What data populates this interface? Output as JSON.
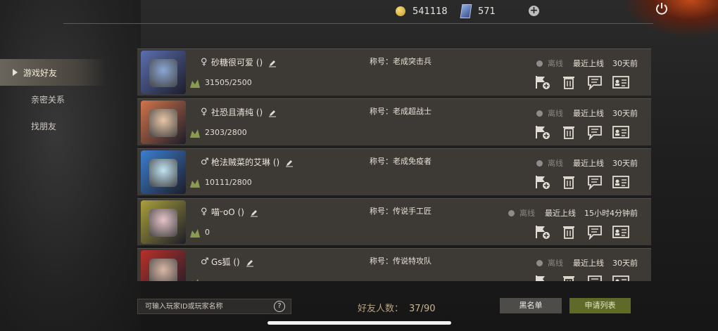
{
  "header": {
    "coins": "541118",
    "cards": "571",
    "coin_icon": "gold-coin-icon",
    "card_icon": "card-icon"
  },
  "sidebar": {
    "items": [
      {
        "label": "游戏好友",
        "active": true
      },
      {
        "label": "亲密关系",
        "active": false
      },
      {
        "label": "找朋友",
        "active": false
      }
    ]
  },
  "friends": [
    {
      "gender": "♀",
      "name": "砂糖很可爱 ()",
      "score": "31505/2500",
      "title": "称号：老成突击兵",
      "status": "离线",
      "last_label": "最近上线",
      "last_seen": "30天前",
      "frame_color": "#5a6fb0",
      "face_color": "#8aa6d6"
    },
    {
      "gender": "♀",
      "name": "社恐且清纯 ()",
      "score": "2303/2800",
      "title": "称号：老成超战士",
      "status": "离线",
      "last_label": "最近上线",
      "last_seen": "30天前",
      "frame_color": "#d0744a",
      "face_color": "#e8c6a6"
    },
    {
      "gender": "♂",
      "name": "枪法贼菜的艾琳 ()",
      "score": "10111/2800",
      "title": "称号：老成免疫者",
      "status": "离线",
      "last_label": "最近上线",
      "last_seen": "30天前",
      "frame_color": "#3b7fd0",
      "face_color": "#bfe3f2"
    },
    {
      "gender": "♀",
      "name": "喵ᵕoO ()",
      "score": "0",
      "title": "称号：传说手工匠",
      "status": "离线",
      "last_label": "最近上线",
      "last_seen": "15小时4分钟前",
      "frame_color": "#a9a03a",
      "face_color": "#e6c3c8"
    },
    {
      "gender": "♂",
      "name": "Gs狐 ()",
      "score": "",
      "title": "称号：传说特攻队",
      "status": "离线",
      "last_label": "最近上线",
      "last_seen": "30天前",
      "frame_color": "#b8302a",
      "face_color": "#d9b7a4"
    }
  ],
  "footer": {
    "search_placeholder": "可输入玩家ID或玩家名称",
    "friend_count_label": "好友人数：",
    "friend_count": "37/90",
    "blacklist_label": "黑名单",
    "apply_label": "申请列表"
  },
  "colors": {
    "accent_green": "#5f6a2a",
    "row_bg": "#3d3a36",
    "offline_dot": "#8c8c8c"
  }
}
